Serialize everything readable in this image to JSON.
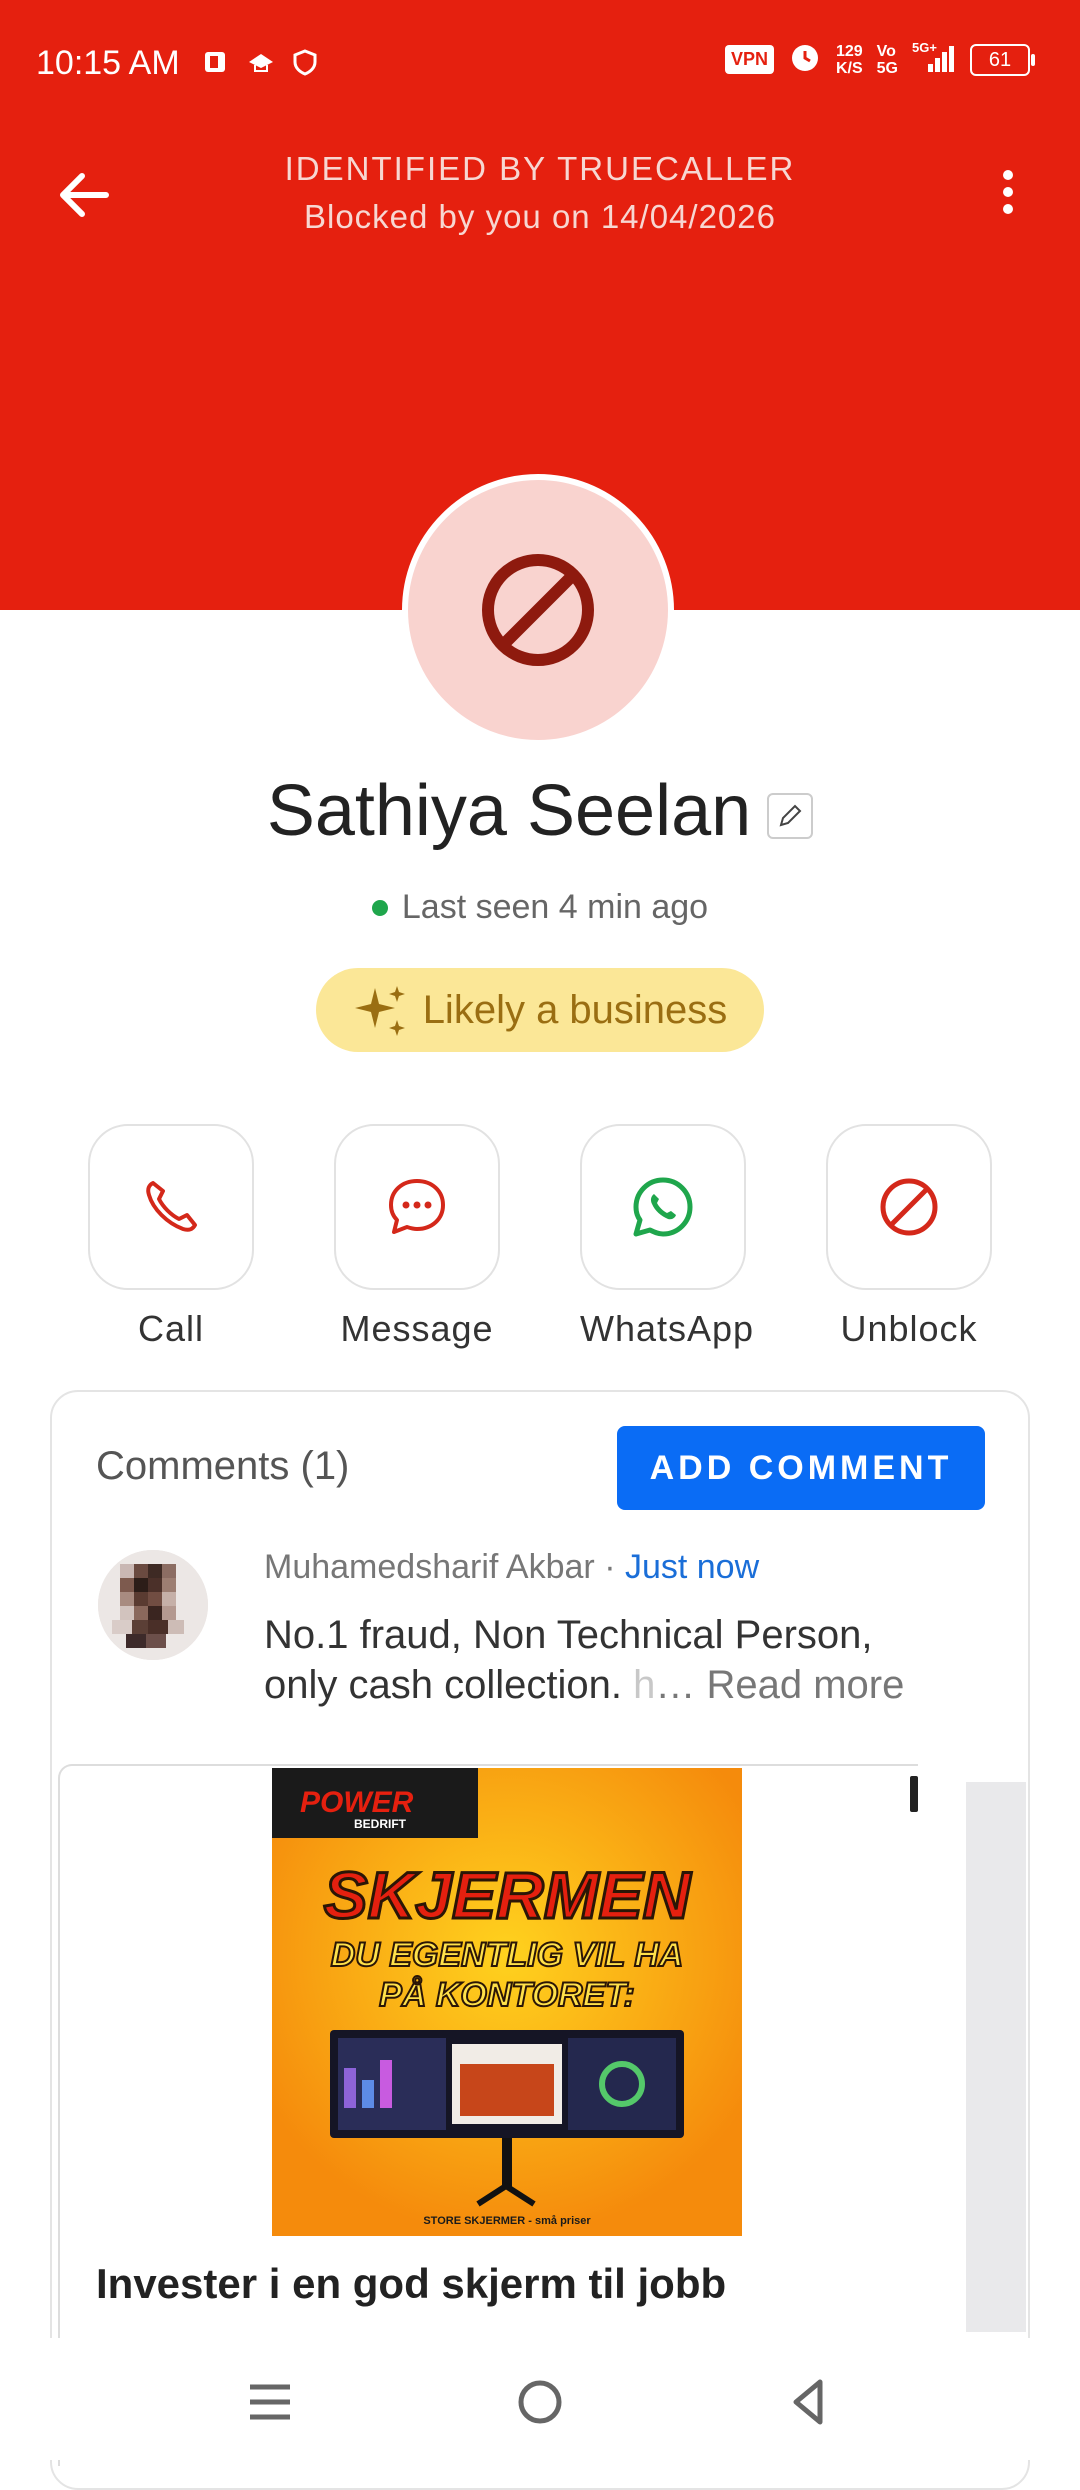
{
  "status_bar": {
    "time": "10:15 AM",
    "vpn": "VPN",
    "net_speed_value": "129",
    "net_speed_unit": "K/S",
    "volte_top": "Vo",
    "volte_bottom": "5G",
    "network": "5G+",
    "battery": "61"
  },
  "header": {
    "line1": "IDENTIFIED BY TRUECALLER",
    "line2": "Blocked by you on 14/04/2026",
    "colors": {
      "background": "#e5200f"
    }
  },
  "profile": {
    "name": "Sathiya Seelan",
    "last_seen": "Last seen 4 min ago",
    "business_badge": "Likely a business",
    "avatar_icon": "block-icon"
  },
  "actions": [
    {
      "label": "Call",
      "icon": "phone-icon"
    },
    {
      "label": "Message",
      "icon": "chat-bubble-icon"
    },
    {
      "label": "WhatsApp",
      "icon": "whatsapp-icon"
    },
    {
      "label": "Unblock",
      "icon": "block-icon"
    }
  ],
  "comments": {
    "title": "Comments (1)",
    "add_button": "ADD COMMENT",
    "items": [
      {
        "author": "Muhamedsharif Akbar",
        "separator": "·",
        "time": "Just now",
        "text_line1": "No.1 fraud, Non Technical Person,",
        "text_line2": "only cash collection.",
        "text_fade": "h",
        "ellipsis": "…",
        "read_more": "Read more"
      }
    ]
  },
  "ad": {
    "brand_top": "POWER",
    "brand_bottom": "BEDRIFT",
    "big_text": "SKJERMEN",
    "sub_text_1": "DU EGENTLIG VIL HA",
    "sub_text_2": "PÅ KONTORET:",
    "footer": "STORE SKJERMER - små priser",
    "headline": "Invester i en god skjerm til jobb"
  }
}
